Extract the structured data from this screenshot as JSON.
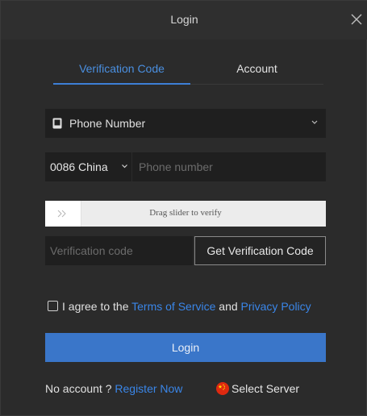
{
  "window": {
    "title": "Login"
  },
  "tabs": [
    {
      "label": "Verification Code",
      "active": true
    },
    {
      "label": "Account",
      "active": false
    }
  ],
  "phone_type": {
    "label": "Phone Number",
    "icon": "phone-icon"
  },
  "country": {
    "label": "0086 China"
  },
  "phone": {
    "placeholder": "Phone number",
    "value": ""
  },
  "slider": {
    "text": "Drag slider to verify",
    "handle_icon": "double-chevron-right-icon"
  },
  "code": {
    "placeholder": "Verification code",
    "value": "",
    "button_label": "Get Verification Code"
  },
  "agreement": {
    "prefix": "I agree to the ",
    "terms_label": "Terms of Service",
    "conjunction": " and ",
    "privacy_label": "Privacy Policy",
    "checked": false
  },
  "login_button": {
    "label": "Login"
  },
  "footer": {
    "no_account_text": "No account ? ",
    "register_label": "Register Now",
    "server_label": "Select Server",
    "server_icon": "china-flag-icon"
  },
  "colors": {
    "background": "#2b2b2b",
    "field": "#1f1f1f",
    "accent": "#3a76c9",
    "link": "#3a86e8",
    "active_tab": "#4a8fe0"
  }
}
